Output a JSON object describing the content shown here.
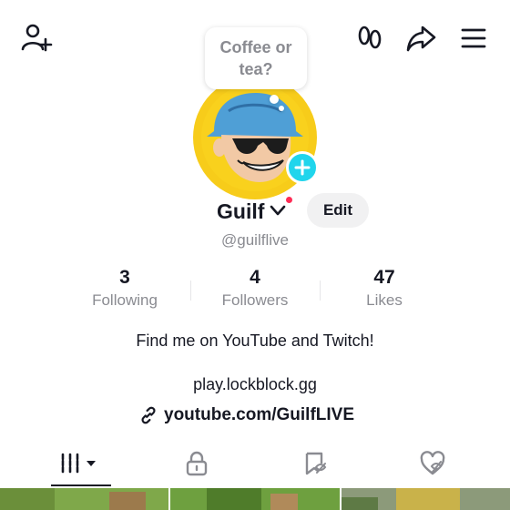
{
  "header": {
    "icons": [
      "add-friend-icon",
      "footprints-icon",
      "share-icon",
      "menu-icon"
    ]
  },
  "profile": {
    "bubble_text": "Coffee or tea?",
    "name": "Guilf",
    "handle": "@guilflive",
    "edit_label": "Edit"
  },
  "stats": [
    {
      "value": "3",
      "label": "Following"
    },
    {
      "value": "4",
      "label": "Followers"
    },
    {
      "value": "47",
      "label": "Likes"
    }
  ],
  "bio": {
    "line1": "Find me on YouTube and Twitch!",
    "line2": "play.lockblock.gg",
    "link": "youtube.com/GuilfLIVE"
  },
  "tabs": {
    "items": [
      "videos-grid-icon",
      "lock-icon",
      "repost-icon",
      "liked-icon"
    ],
    "selected": "videos-grid-icon"
  },
  "colors": {
    "accent_cyan": "#20d5ec",
    "live_red": "#fe2c55",
    "avatar_ring": "#f7cc1a",
    "text_primary": "#161823",
    "text_secondary": "#8a8b91"
  }
}
